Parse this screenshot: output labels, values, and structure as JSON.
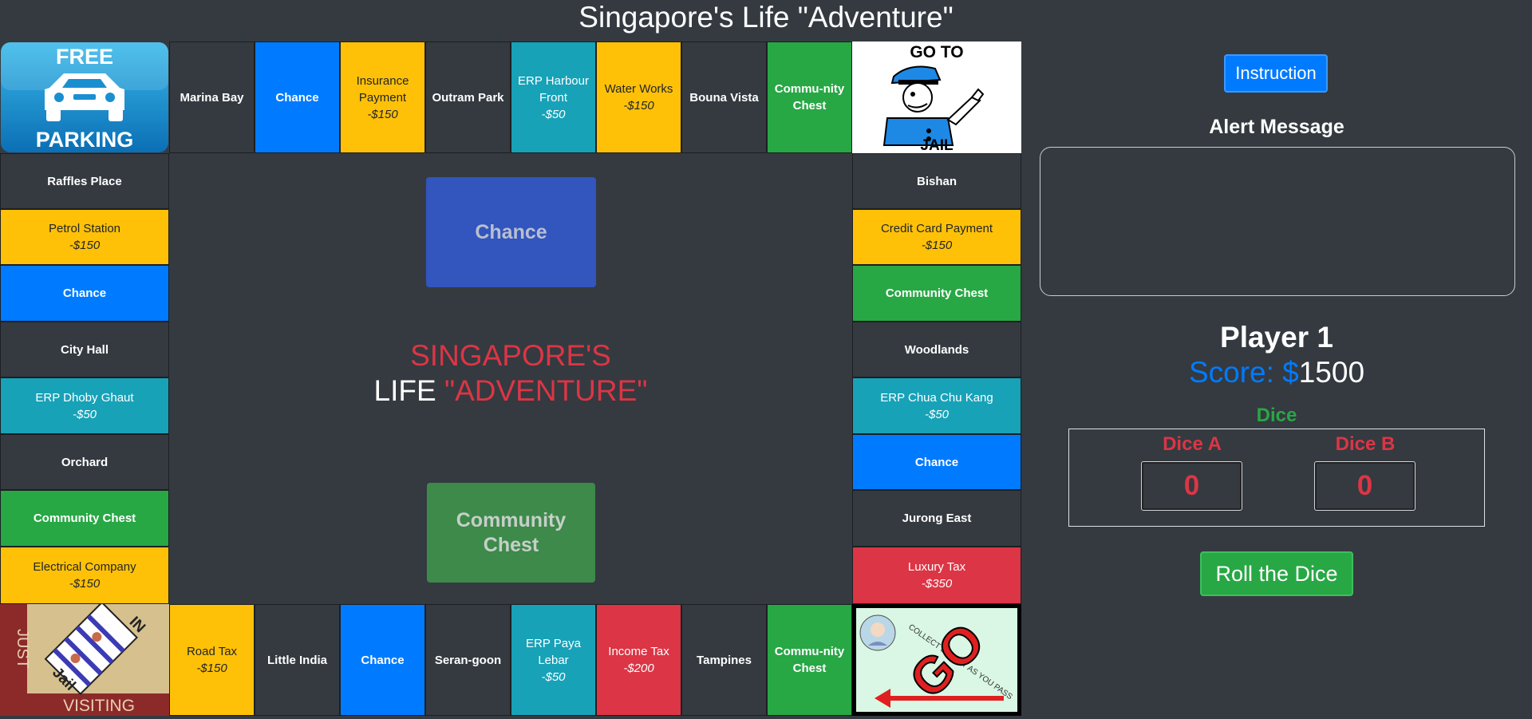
{
  "page_title": "Singapore's Life \"Adventure\"",
  "board": {
    "corners": {
      "free_parking": {
        "line1": "FREE",
        "line2": "PARKING"
      },
      "go_to_jail": {
        "line1": "GO TO",
        "line2": "JAIL"
      },
      "jail": {
        "just": "JUST",
        "in": "IN",
        "jail": "Jail",
        "visiting": "VISITING"
      },
      "go": {
        "text": "GO",
        "arc_text": "COLLECT SALARY AS YOU PASS"
      }
    },
    "top": [
      {
        "name": "Marina Bay",
        "price": "",
        "color": "dark"
      },
      {
        "name": "Chance",
        "price": "",
        "color": "blue"
      },
      {
        "name": "Insurance Payment",
        "price": "-$150",
        "color": "yellow"
      },
      {
        "name": "Outram Park",
        "price": "",
        "color": "dark"
      },
      {
        "name": "ERP Harbour Front",
        "price": "-$50",
        "color": "teal"
      },
      {
        "name": "Water Works",
        "price": "-$150",
        "color": "yellow"
      },
      {
        "name": "Bouna Vista",
        "price": "",
        "color": "dark"
      },
      {
        "name": "Commu-nity Chest",
        "price": "",
        "color": "green"
      }
    ],
    "left": [
      {
        "name": "Raffles Place",
        "price": "",
        "color": "dark"
      },
      {
        "name": "Petrol Station",
        "price": "-$150",
        "color": "yellow"
      },
      {
        "name": "Chance",
        "price": "",
        "color": "blue"
      },
      {
        "name": "City Hall",
        "price": "",
        "color": "dark"
      },
      {
        "name": "ERP Dhoby Ghaut",
        "price": "-$50",
        "color": "teal"
      },
      {
        "name": "Orchard",
        "price": "",
        "color": "dark"
      },
      {
        "name": "Community Chest",
        "price": "",
        "color": "green"
      },
      {
        "name": "Electrical Company",
        "price": "-$150",
        "color": "yellow"
      }
    ],
    "right": [
      {
        "name": "Bishan",
        "price": "",
        "color": "dark"
      },
      {
        "name": "Credit Card Payment",
        "price": "-$150",
        "color": "yellow"
      },
      {
        "name": "Community Chest",
        "price": "",
        "color": "green"
      },
      {
        "name": "Woodlands",
        "price": "",
        "color": "dark"
      },
      {
        "name": "ERP Chua Chu Kang",
        "price": "-$50",
        "color": "teal"
      },
      {
        "name": "Chance",
        "price": "",
        "color": "blue"
      },
      {
        "name": "Jurong East",
        "price": "",
        "color": "dark"
      },
      {
        "name": "Luxury Tax",
        "price": "-$350",
        "color": "red"
      }
    ],
    "bottom": [
      {
        "name": "Road Tax",
        "price": "-$150",
        "color": "yellow"
      },
      {
        "name": "Little India",
        "price": "",
        "color": "dark"
      },
      {
        "name": "Chance",
        "price": "",
        "color": "blue"
      },
      {
        "name": "Seran-goon",
        "price": "",
        "color": "dark"
      },
      {
        "name": "ERP Paya Lebar",
        "price": "-$50",
        "color": "teal"
      },
      {
        "name": "Income Tax",
        "price": "-$200",
        "color": "red"
      },
      {
        "name": "Tampines",
        "price": "",
        "color": "dark"
      },
      {
        "name": "Commu-nity Chest",
        "price": "",
        "color": "green"
      }
    ],
    "center": {
      "chance_card": "Chance",
      "community_card": "Community Chest",
      "title_line1": "SINGAPORE'S",
      "title_line2_a": "LIFE",
      "title_line2_b": "\"ADVENTURE\""
    }
  },
  "panel": {
    "instruction_button": "Instruction",
    "alert_title": "Alert Message",
    "alert_message": "",
    "player_name": "Player 1",
    "score_label": "Score: $",
    "score_value": "1500",
    "dice_title": "Dice",
    "dice_a_label": "Dice A",
    "dice_b_label": "Dice B",
    "dice_a_value": "0",
    "dice_b_value": "0",
    "roll_button": "Roll the Dice"
  },
  "colors": {
    "dark": "#343a40",
    "blue": "#007bff",
    "yellow": "#ffc107",
    "teal": "#17a2b8",
    "green": "#28a745",
    "red": "#dc3545"
  }
}
